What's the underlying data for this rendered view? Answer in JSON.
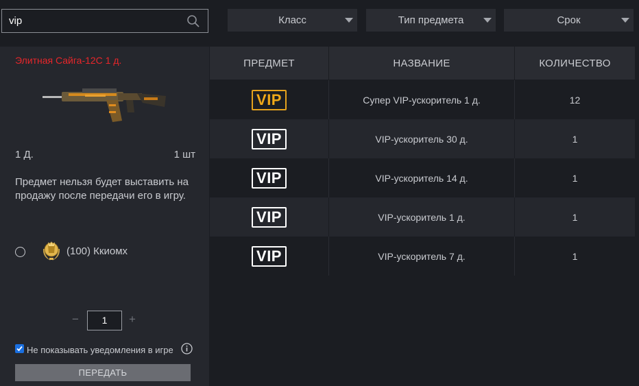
{
  "search": {
    "value": "vip"
  },
  "filters": [
    {
      "label": "Класс"
    },
    {
      "label": "Тип предмета"
    },
    {
      "label": "Срок"
    }
  ],
  "item": {
    "title": "Элитная Сайга-12С 1 д.",
    "duration": "1 Д.",
    "quantity": "1 шт",
    "notice": "Предмет нельзя будет выставить на продажу после передачи его в игру."
  },
  "recipient": {
    "name": "(100) Ккиомх"
  },
  "stepper": {
    "value": "1",
    "minus": "−",
    "plus": "+"
  },
  "notifications": {
    "label": "Не показывать уведомления в игре",
    "checked": true
  },
  "send_button": "ПЕРЕДАТЬ",
  "table": {
    "headers": [
      "ПРЕДМЕТ",
      "НАЗВАНИЕ",
      "КОЛИЧЕСТВО"
    ],
    "rows": [
      {
        "icon": "VIP",
        "icon_color": "gold",
        "name": "Супер VIP-ускоритель 1 д.",
        "count": "12"
      },
      {
        "icon": "VIP",
        "icon_color": "white",
        "name": "VIP-ускоритель 30 д.",
        "count": "1"
      },
      {
        "icon": "VIP",
        "icon_color": "white",
        "name": "VIP-ускоритель 14 д.",
        "count": "1"
      },
      {
        "icon": "VIP",
        "icon_color": "white",
        "name": "VIP-ускоритель 1 д.",
        "count": "1"
      },
      {
        "icon": "VIP",
        "icon_color": "white",
        "name": "VIP-ускоритель 7 д.",
        "count": "1"
      }
    ]
  },
  "colors": {
    "accent_red": "#e8262a",
    "vip_gold": "#f0a818",
    "checkbox_blue": "#1a6fe0"
  }
}
